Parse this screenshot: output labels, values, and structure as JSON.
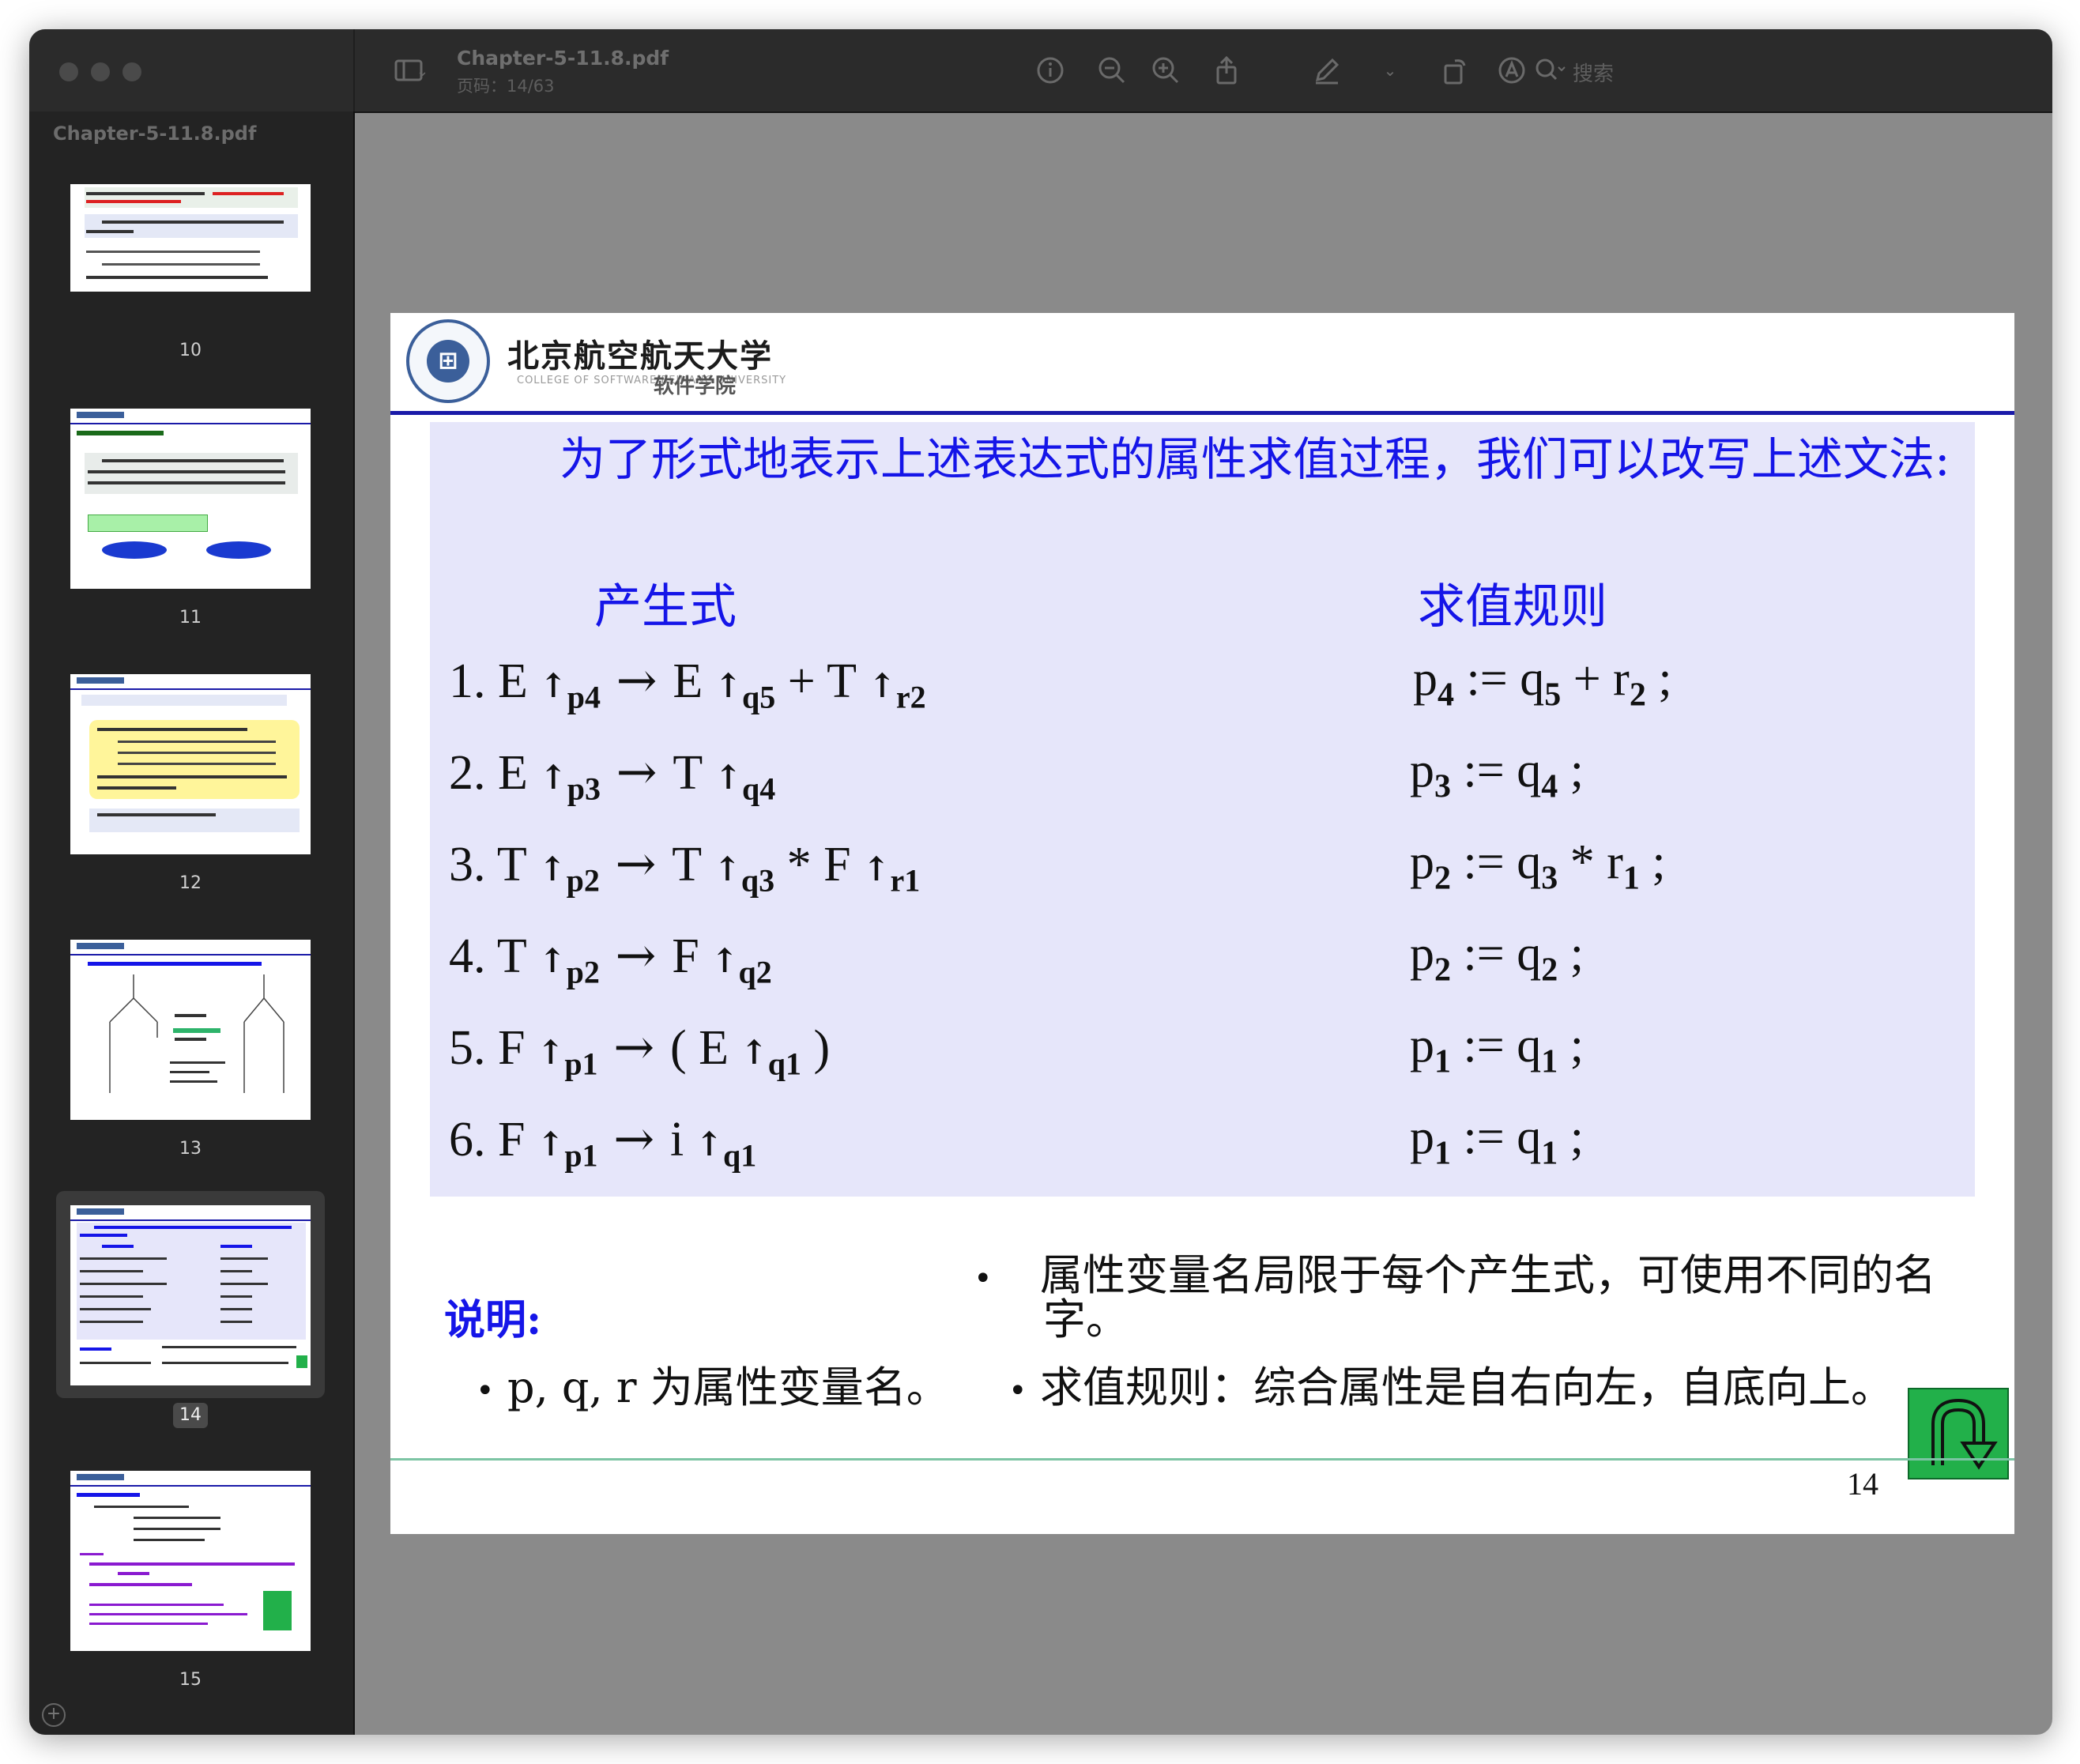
{
  "toolbar": {
    "doc_title": "Chapter-5-11.8.pdf",
    "page_indicator": "页码：14/63",
    "search_placeholder": "搜索"
  },
  "sidebar": {
    "title": "Chapter-5-11.8.pdf",
    "thumbnails": [
      {
        "label": "10"
      },
      {
        "label": "11"
      },
      {
        "label": "12"
      },
      {
        "label": "13"
      },
      {
        "label": "14",
        "selected": true
      },
      {
        "label": "15"
      }
    ]
  },
  "slide": {
    "university_name": "北京航空航天大学",
    "college_sub": "COLLEGE OF SOFTWARE BEIHANG UNIVERSITY",
    "college_name": "软件学院",
    "intro": "为了形式地表示上述表达式的属性求值过程，我们可以改写上述文法:",
    "col_productions": "产生式",
    "col_rules": "求值规则",
    "productions": [
      {
        "num": "1.",
        "lhs": "E",
        "lhs_sub": "p4",
        "rhs": [
          [
            "E",
            "q5"
          ],
          [
            "+",
            ""
          ],
          [
            "T",
            "r2"
          ]
        ]
      },
      {
        "num": "2.",
        "lhs": "E",
        "lhs_sub": "p3",
        "rhs": [
          [
            "T",
            "q4"
          ]
        ]
      },
      {
        "num": "3.",
        "lhs": "T",
        "lhs_sub": "p2",
        "rhs": [
          [
            "T",
            "q3"
          ],
          [
            "*",
            ""
          ],
          [
            "F",
            "r1"
          ]
        ]
      },
      {
        "num": "4.",
        "lhs": "T",
        "lhs_sub": "p2",
        "rhs": [
          [
            "F",
            "q2"
          ]
        ]
      },
      {
        "num": "5.",
        "lhs": "F",
        "lhs_sub": "p1",
        "rhs": [
          [
            "(",
            ""
          ],
          [
            "E",
            "q1"
          ],
          [
            ")",
            ""
          ]
        ]
      },
      {
        "num": "6.",
        "lhs": "F",
        "lhs_sub": "p1",
        "rhs": [
          [
            "i",
            "q1"
          ]
        ]
      }
    ],
    "rules": [
      {
        "a": "p",
        "a_sub": "4",
        "b": "q",
        "b_sub": "5",
        "op": "+",
        "c": "r",
        "c_sub": "2"
      },
      {
        "a": "p",
        "a_sub": "3",
        "b": "q",
        "b_sub": "4"
      },
      {
        "a": "p",
        "a_sub": "2",
        "b": "q",
        "b_sub": "3",
        "op": "*",
        "c": "r",
        "c_sub": "1"
      },
      {
        "a": "p",
        "a_sub": "2",
        "b": "q",
        "b_sub": "2"
      },
      {
        "a": "p",
        "a_sub": "1",
        "b": "q",
        "b_sub": "1"
      },
      {
        "a": "p",
        "a_sub": "1",
        "b": "q",
        "b_sub": "1"
      }
    ],
    "note_label": "说明:",
    "bullet_1": "p, q, r 为属性变量名。",
    "bullet_2": "属性变量名局限于每个产生式，可使用不同的名字。",
    "bullet_3": "求值规则：综合属性是自右向左，自底向上。",
    "page_number": "14"
  }
}
